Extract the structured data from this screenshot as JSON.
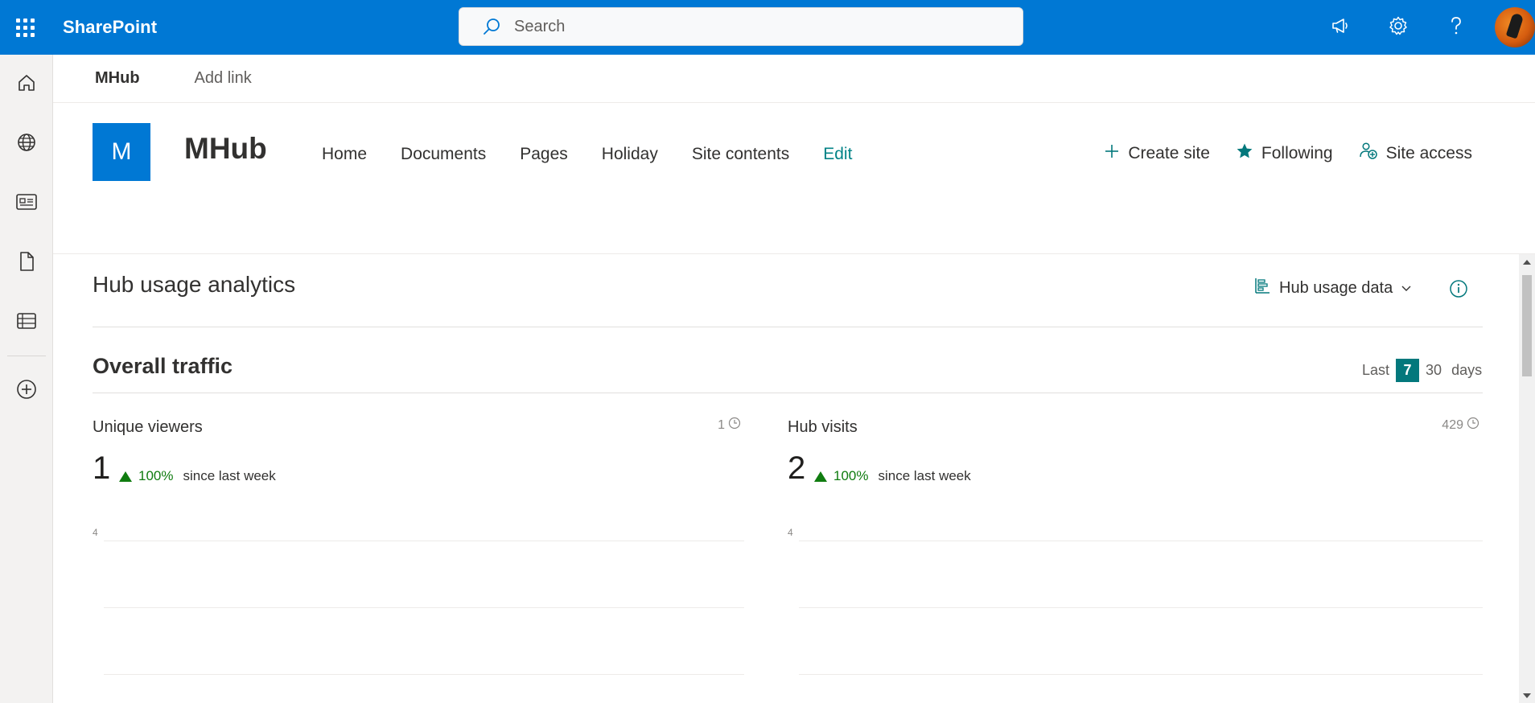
{
  "suitebar": {
    "app_name": "SharePoint",
    "search_placeholder": "Search",
    "brand_color": "#0078d4"
  },
  "left_rail": {
    "icons": [
      "home-icon",
      "globe-icon",
      "news-icon",
      "file-icon",
      "list-icon",
      "create-icon"
    ]
  },
  "hub_nav": {
    "home_label": "MHub",
    "add_link_label": "Add link"
  },
  "site": {
    "logo_letter": "M",
    "title": "MHub",
    "nav": [
      "Home",
      "Documents",
      "Pages",
      "Holiday",
      "Site contents"
    ],
    "edit_label": "Edit",
    "actions": {
      "create_site": "Create site",
      "following": "Following",
      "site_access": "Site access"
    }
  },
  "analytics": {
    "title": "Hub usage analytics",
    "data_selector": "Hub usage data",
    "overall_traffic": "Overall traffic",
    "range": {
      "last": "Last",
      "seven": "7",
      "thirty": "30",
      "days": "days",
      "selected": "7",
      "selected_color": "#03787c"
    },
    "cards": [
      {
        "title": "Unique viewers",
        "total": "1",
        "value": "1",
        "delta": "100%",
        "since": "since last week",
        "y_tick": "4"
      },
      {
        "title": "Hub visits",
        "total": "429",
        "value": "2",
        "delta": "100%",
        "since": "since last week",
        "y_tick": "4"
      }
    ]
  }
}
